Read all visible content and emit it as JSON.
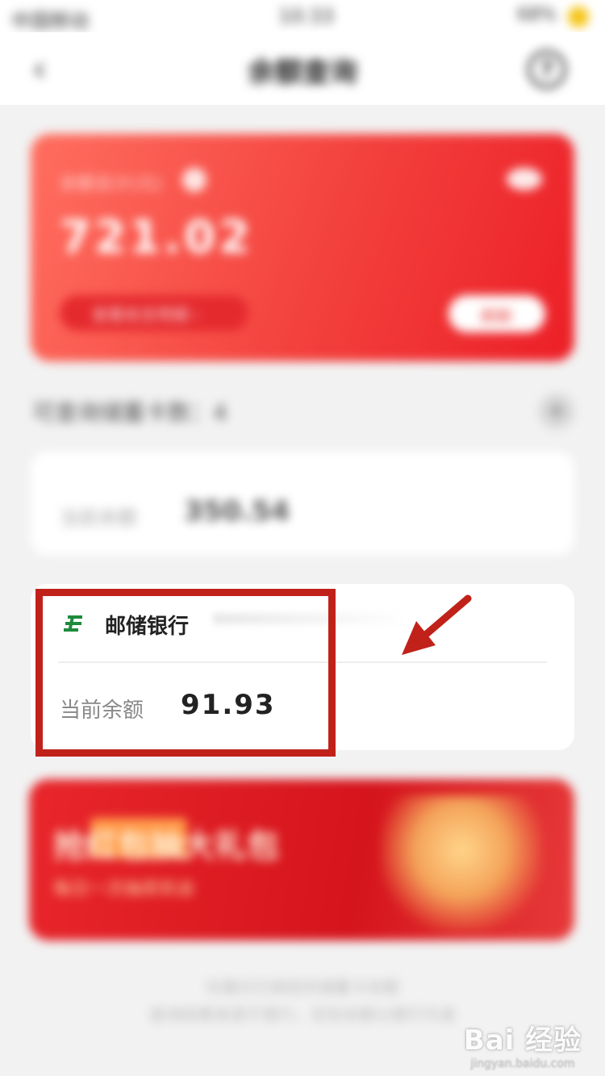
{
  "status_bar": {
    "carrier": "中国移动",
    "time": "10:33",
    "battery": "68%"
  },
  "header": {
    "title": "余额查询",
    "back_glyph": "‹",
    "help_glyph": "?"
  },
  "summary_card": {
    "label": "余额总计(元)",
    "amount": "721.02",
    "detail_link": "查看收支明细 ›",
    "action_button": "刷新"
  },
  "accounts_section": {
    "title": "可查询储蓄卡数：4",
    "add_glyph": "+"
  },
  "account_card_1": {
    "balance_label": "当前余额",
    "balance_value": "350.54"
  },
  "account_card_2": {
    "bank_name": "邮储银行",
    "balance_label": "当前余额",
    "balance_value": "91.93",
    "logo_color": "#1e8a3c"
  },
  "promo": {
    "title": "抢红包抽大礼包",
    "subtitle": "每日一次抽奖机会"
  },
  "footer": {
    "line1": "仅展示已绑定的储蓄卡余额",
    "line2": "查询结果来源于银行，实际余额以银行为准"
  },
  "annotation": {
    "color": "#c0221a"
  },
  "watermark": {
    "logo": "Bai 经验",
    "url": "jingyan.baidu.com"
  }
}
